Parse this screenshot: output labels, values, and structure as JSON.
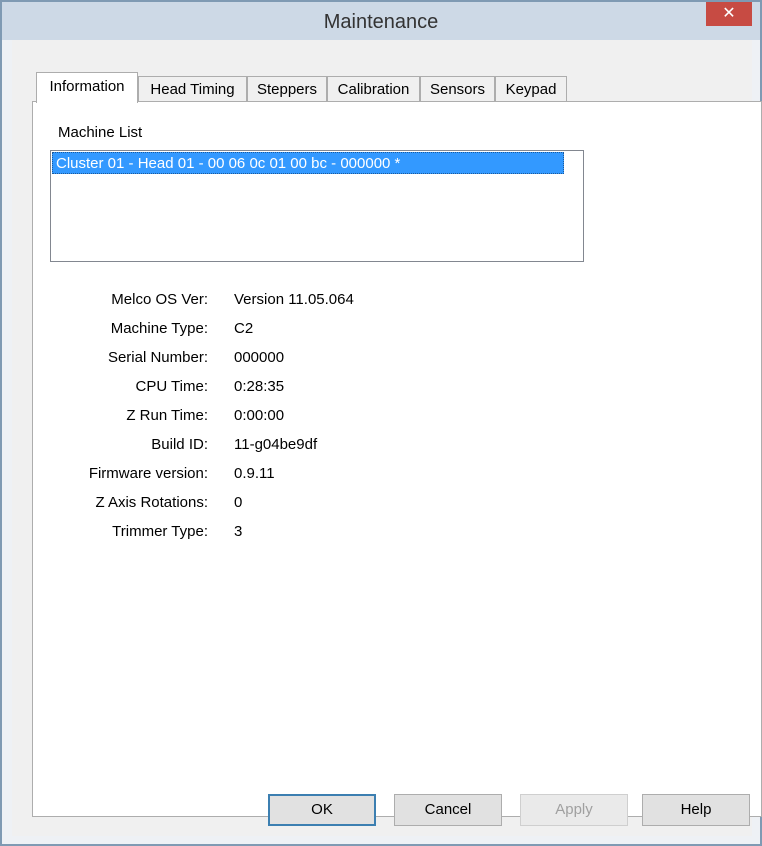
{
  "window": {
    "title": "Maintenance",
    "close_glyph": "✕"
  },
  "tabs": [
    {
      "label": "Information",
      "active": true
    },
    {
      "label": "Head Timing",
      "active": false
    },
    {
      "label": "Steppers",
      "active": false
    },
    {
      "label": "Calibration",
      "active": false
    },
    {
      "label": "Sensors",
      "active": false
    },
    {
      "label": "Keypad",
      "active": false
    }
  ],
  "machine_list": {
    "label": "Machine List",
    "items": [
      "Cluster 01 - Head 01 - 00 06 0c 01 00 bc - 000000 *"
    ],
    "selected_index": 0
  },
  "info": [
    {
      "label": "Melco OS Ver:",
      "value": "Version 11.05.064"
    },
    {
      "label": "Machine Type:",
      "value": "C2"
    },
    {
      "label": "Serial Number:",
      "value": "000000"
    },
    {
      "label": "CPU Time:",
      "value": "0:28:35"
    },
    {
      "label": "Z Run Time:",
      "value": "0:00:00"
    },
    {
      "label": "Build ID:",
      "value": "11-g04be9df"
    },
    {
      "label": "Firmware version:",
      "value": "0.9.11"
    },
    {
      "label": "Z Axis Rotations:",
      "value": "0"
    },
    {
      "label": "Trimmer Type:",
      "value": "3"
    }
  ],
  "buttons": {
    "ok": "OK",
    "cancel": "Cancel",
    "apply": "Apply",
    "help": "Help"
  },
  "colors": {
    "selection": "#3399ff",
    "close_button": "#c74b43",
    "titlebar": "#cdd9e6"
  }
}
